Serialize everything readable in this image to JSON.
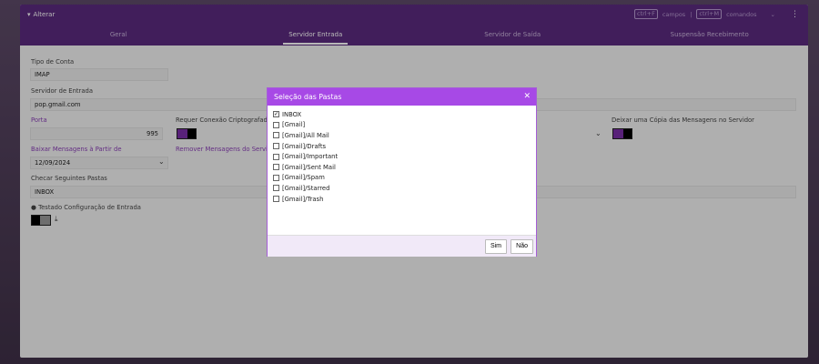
{
  "titlebar": {
    "title": "Alterar",
    "shortcut1_key": "ctrl+F",
    "shortcut1_label": "campos",
    "separator": "|",
    "shortcut2_key": "ctrl+M",
    "shortcut2_label": "comandos",
    "chevron": "⌄",
    "menu": "⋮"
  },
  "tabs": [
    "Geral",
    "Servidor Entrada",
    "Servidor de Saída",
    "Suspensão Recebimento"
  ],
  "form": {
    "tipo_label": "Tipo de Conta",
    "tipo_value": "IMAP",
    "servidor_label": "Servidor de Entrada",
    "servidor_value": "pop.gmail.com",
    "porta_label": "Porta",
    "porta_value": "995",
    "cripto_label": "Requer Conexão Criptografada",
    "copia_label": "Deixar uma Cópia das Mensagens no Servidor",
    "baixar_label": "Baixar Mensagens à Partir de",
    "baixar_value": "12/09/2024",
    "remover_label": "Remover Mensagens do Servid",
    "checar_label": "Checar Seguintes Pastas",
    "checar_value": "INBOX",
    "testado_label": "Testado Configuração de Entrada"
  },
  "dialog": {
    "title": "Seleção das Pastas",
    "close": "✕",
    "folders": [
      {
        "name": "INBOX",
        "checked": true
      },
      {
        "name": "[Gmail]",
        "checked": false
      },
      {
        "name": "[Gmail]/All Mail",
        "checked": false
      },
      {
        "name": "[Gmail]/Drafts",
        "checked": false
      },
      {
        "name": "[Gmail]/Important",
        "checked": false
      },
      {
        "name": "[Gmail]/Sent Mail",
        "checked": false
      },
      {
        "name": "[Gmail]/Spam",
        "checked": false
      },
      {
        "name": "[Gmail]/Starred",
        "checked": false
      },
      {
        "name": "[Gmail]/Trash",
        "checked": false
      }
    ],
    "yes": "Sim",
    "no": "Não"
  }
}
